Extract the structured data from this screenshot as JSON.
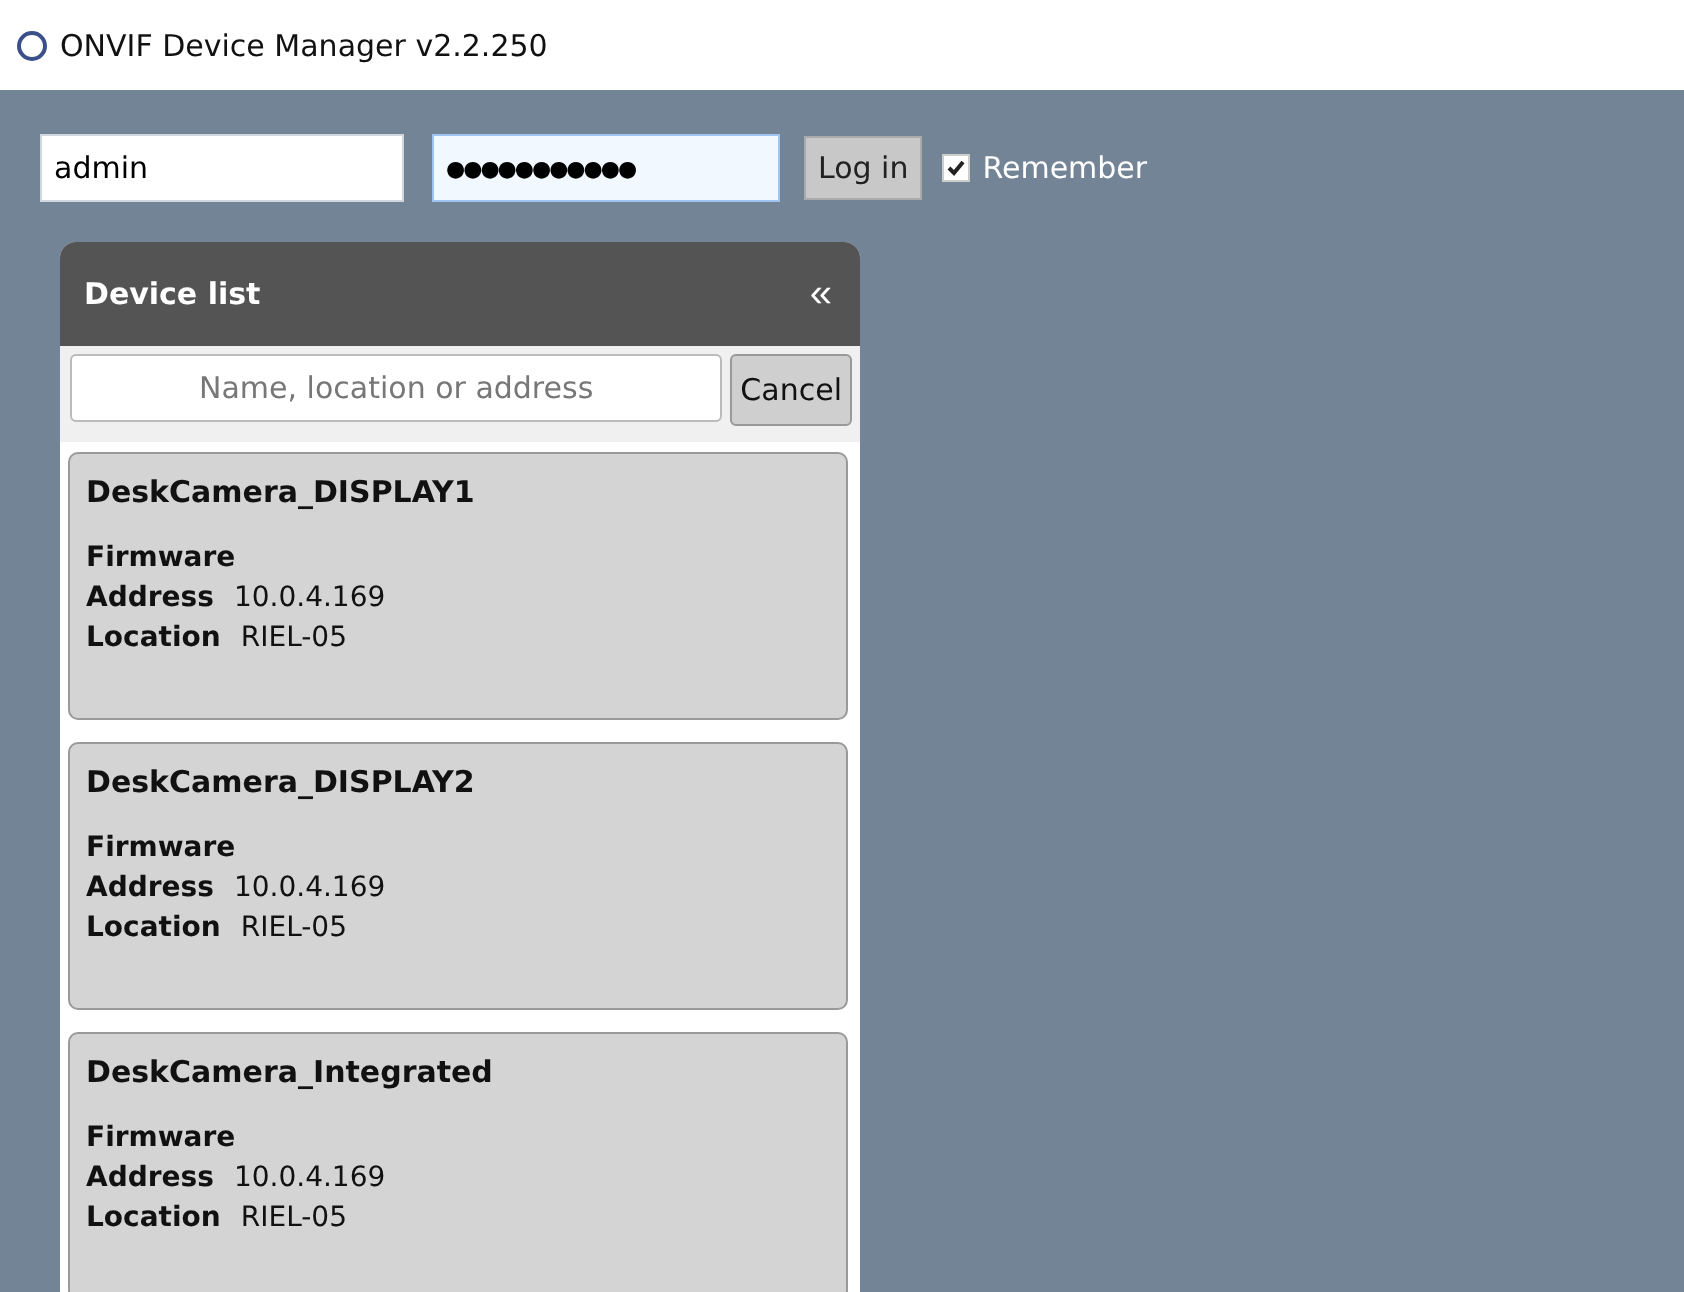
{
  "window": {
    "title": "ONVIF Device Manager v2.2.250"
  },
  "login": {
    "username": "admin",
    "password": "●●●●●●●●●●●",
    "button": "Log in",
    "remember": {
      "label": "Remember",
      "checked": true
    }
  },
  "device_list": {
    "title": "Device list",
    "collapse": "«",
    "search": {
      "placeholder": "Name, location or address"
    },
    "cancel": "Cancel",
    "devices": [
      {
        "name": "DeskCamera_DISPLAY1",
        "fields": [
          {
            "label": "Firmware"
          },
          {
            "label": "Address",
            "value": "10.0.4.169"
          },
          {
            "label": "Location",
            "value": "RIEL-05"
          }
        ]
      },
      {
        "name": "DeskCamera_DISPLAY2",
        "fields": [
          {
            "label": "Firmware"
          },
          {
            "label": "Address",
            "value": "10.0.4.169"
          },
          {
            "label": "Location",
            "value": "RIEL-05"
          }
        ]
      },
      {
        "name": "DeskCamera_Integrated",
        "fields": [
          {
            "label": "Firmware"
          },
          {
            "label": "Address",
            "value": "10.0.4.169"
          },
          {
            "label": "Location",
            "value": "RIEL-05"
          }
        ]
      }
    ]
  }
}
